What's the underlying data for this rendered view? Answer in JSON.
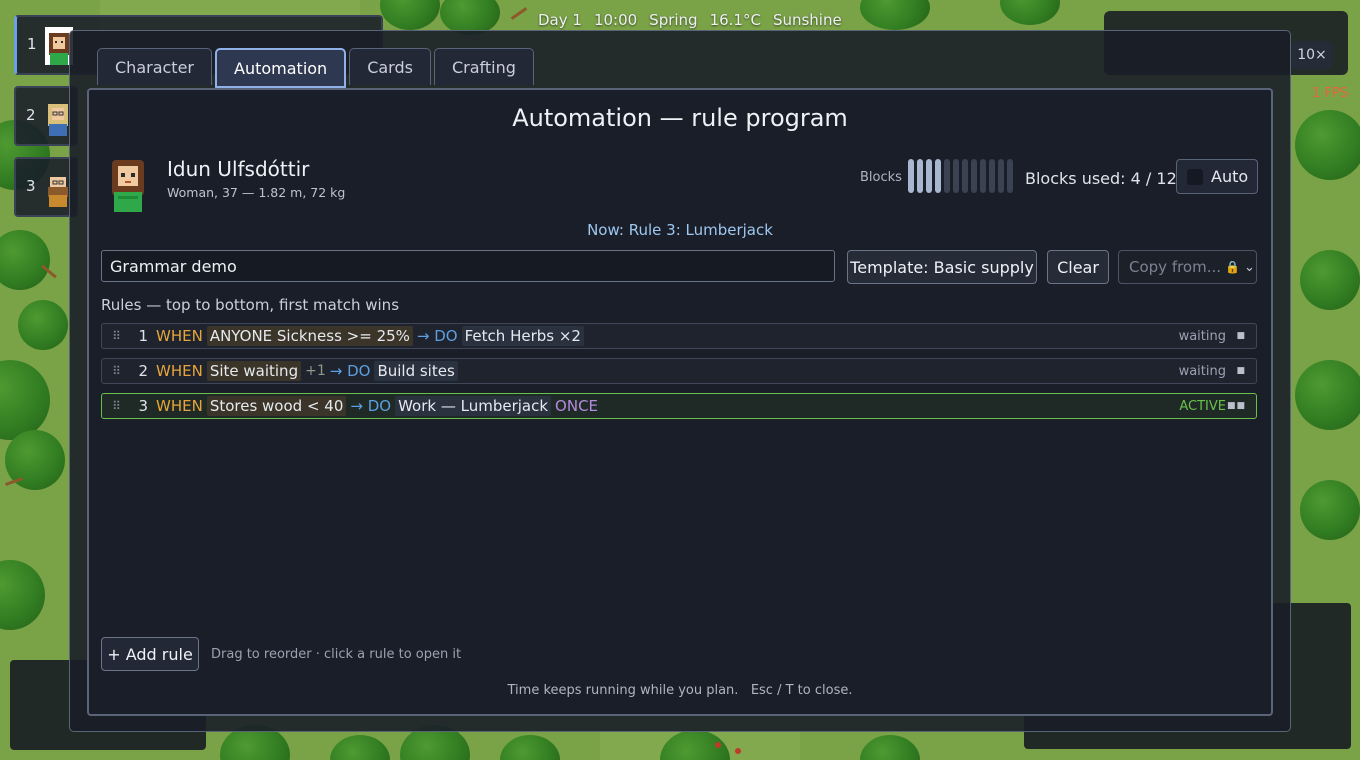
{
  "hud": {
    "day": "Day 1",
    "time": "10:00",
    "season": "Spring",
    "temperature": "16.1°C",
    "weather": "Sunshine",
    "speed_active": "10×",
    "fps": "1 FPS"
  },
  "roster": [
    {
      "num": "1"
    },
    {
      "num": "2"
    },
    {
      "num": "3"
    }
  ],
  "tabs": [
    {
      "label": "Character"
    },
    {
      "label": "Automation"
    },
    {
      "label": "Cards"
    },
    {
      "label": "Crafting"
    }
  ],
  "panel": {
    "title": "Automation — rule program",
    "character": {
      "name": "Idun Ulfsdóttir",
      "details": "Woman, 37 — 1.82 m, 72 kg"
    },
    "blocks": {
      "label": "Blocks",
      "used": 4,
      "total": 12,
      "used_text": "Blocks used: 4 / 12"
    },
    "auto_label": "Auto",
    "now_running": "Now: Rule 3: Lumberjack",
    "program_name": "Grammar demo",
    "template_button": "Template: Basic supply",
    "clear_button": "Clear",
    "copy_from_placeholder": "Copy from...",
    "rules_heading": "Rules — top to bottom, first match wins",
    "rules": [
      {
        "num": "1",
        "when": "WHEN",
        "condition": "ANYONE Sickness >= 25%",
        "extra": "",
        "do": "→ DO",
        "action": "Fetch Herbs ×2",
        "modifier": "",
        "status": "waiting",
        "dots": "■"
      },
      {
        "num": "2",
        "when": "WHEN",
        "condition": "Site waiting",
        "extra": "+1",
        "do": "→ DO",
        "action": "Build sites",
        "modifier": "",
        "status": "waiting",
        "dots": "■"
      },
      {
        "num": "3",
        "when": "WHEN",
        "condition": "Stores wood < 40",
        "extra": "",
        "do": "→ DO",
        "action": "Work — Lumberjack",
        "modifier": "ONCE",
        "status": "ACTIVE",
        "dots": "■■"
      }
    ],
    "add_rule_button": "+ Add rule",
    "hint": "Drag to reorder · click a rule to open it",
    "footer": "Time keeps running while you plan.   Esc / T to close."
  },
  "colors": {
    "accent": "#8fb1e8",
    "when_keyword": "#e6a53a",
    "do_keyword": "#5c9fe0",
    "once_keyword": "#b58ae0",
    "active_status": "#6ac04c"
  }
}
